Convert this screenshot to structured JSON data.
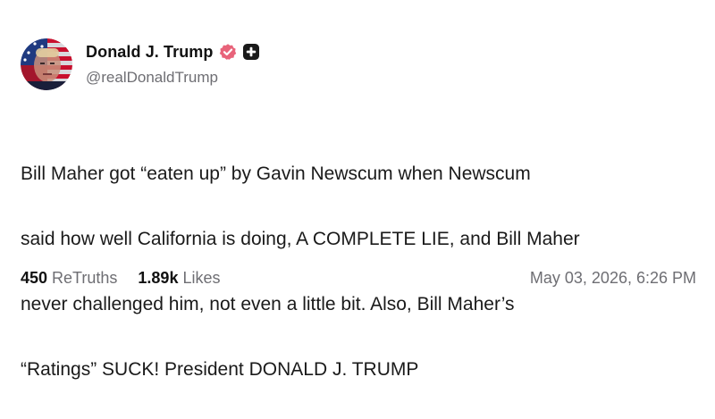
{
  "post": {
    "author": {
      "display_name": "Donald J. Trump",
      "handle": "@realDonaldTrump",
      "avatar_icon": "avatar-portrait-flag",
      "verified_icon": "verified-badge-icon",
      "plus_icon": "plus-badge-icon"
    },
    "text_lines": [
      "Bill Maher got “eaten up” by Gavin Newscum when Newscum",
      "said how well California is doing, A COMPLETE LIE, and Bill Maher",
      "never challenged him, not even a little bit. Also, Bill Maher’s",
      "“Ratings” SUCK! President DONALD J. TRUMP"
    ],
    "stats": {
      "retruths_count": "450",
      "retruths_label": "ReTruths",
      "likes_count": "1.89k",
      "likes_label": "Likes"
    },
    "timestamp": "May 03, 2026, 6:26 PM"
  },
  "colors": {
    "verified": "#e8637a",
    "plus_badge": "#1a1a1a",
    "muted_text": "#6e6e73",
    "body_text": "#1a1a1a"
  }
}
